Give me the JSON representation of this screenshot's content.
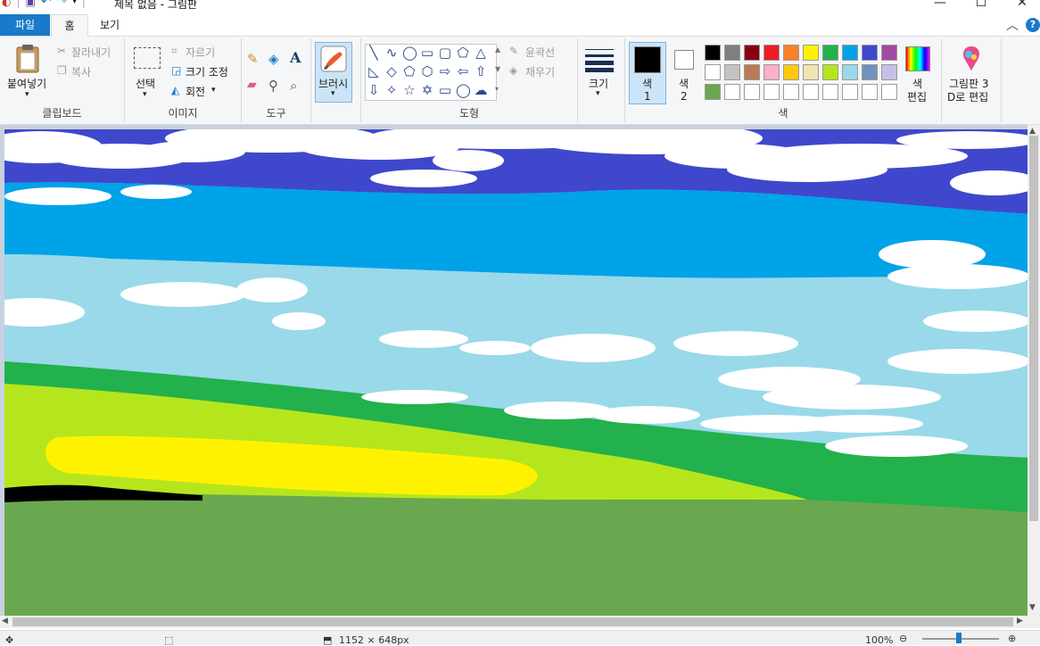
{
  "window": {
    "title": "제목 없음 - 그림판",
    "minimize_glyph": "—",
    "maximize_glyph": "☐",
    "close_glyph": "✕"
  },
  "tabs": {
    "file": "파일",
    "home": "홈",
    "view": "보기"
  },
  "ribbon": {
    "clipboard": {
      "group": "클립보드",
      "paste": "붙여넣기",
      "cut": "잘라내기",
      "copy": "복사"
    },
    "image": {
      "group": "이미지",
      "select": "선택",
      "crop": "자르기",
      "resize": "크기 조정",
      "rotate": "회전"
    },
    "tools": {
      "group": "도구"
    },
    "brushes": {
      "label": "브러시"
    },
    "shapes": {
      "group": "도형",
      "outline": "윤곽선",
      "fill": "채우기"
    },
    "size": {
      "label": "크기"
    },
    "colors": {
      "group": "색",
      "color1_label": "색",
      "color1_num": "1",
      "color2_label": "색",
      "color2_num": "2",
      "edit_colors_line1": "색",
      "edit_colors_line2": "편집",
      "paint3d_line1": "그림판 3",
      "paint3d_line2": "D로 편집",
      "color1": "#000000",
      "color2": "#ffffff",
      "palette_row1": [
        "#000000",
        "#7f7f7f",
        "#880015",
        "#ed1c24",
        "#ff7f27",
        "#fff200",
        "#22b14c",
        "#00a2e8",
        "#3f48cc",
        "#a349a4"
      ],
      "palette_row2": [
        "#ffffff",
        "#c3c3c3",
        "#b97a57",
        "#ffaec9",
        "#ffc90e",
        "#efe4b0",
        "#b5e61d",
        "#99d9ea",
        "#7092be",
        "#c8bfe7"
      ],
      "palette_row3": [
        "#6aa84f",
        "#ffffff",
        "#ffffff",
        "#ffffff",
        "#ffffff",
        "#ffffff",
        "#ffffff",
        "#ffffff",
        "#ffffff",
        "#ffffff"
      ]
    }
  },
  "drawing_colors": {
    "sky_top": "#3f48cc",
    "sky_mid": "#00a2e8",
    "sky_light": "#99d9ea",
    "cloud": "#ffffff",
    "hill_green": "#22b14c",
    "lime": "#b5e61d",
    "yellow": "#fff200",
    "ground": "#6aa84f",
    "stroke_black": "#000000"
  },
  "status": {
    "size": "1152 × 648px",
    "zoom": "100%"
  }
}
